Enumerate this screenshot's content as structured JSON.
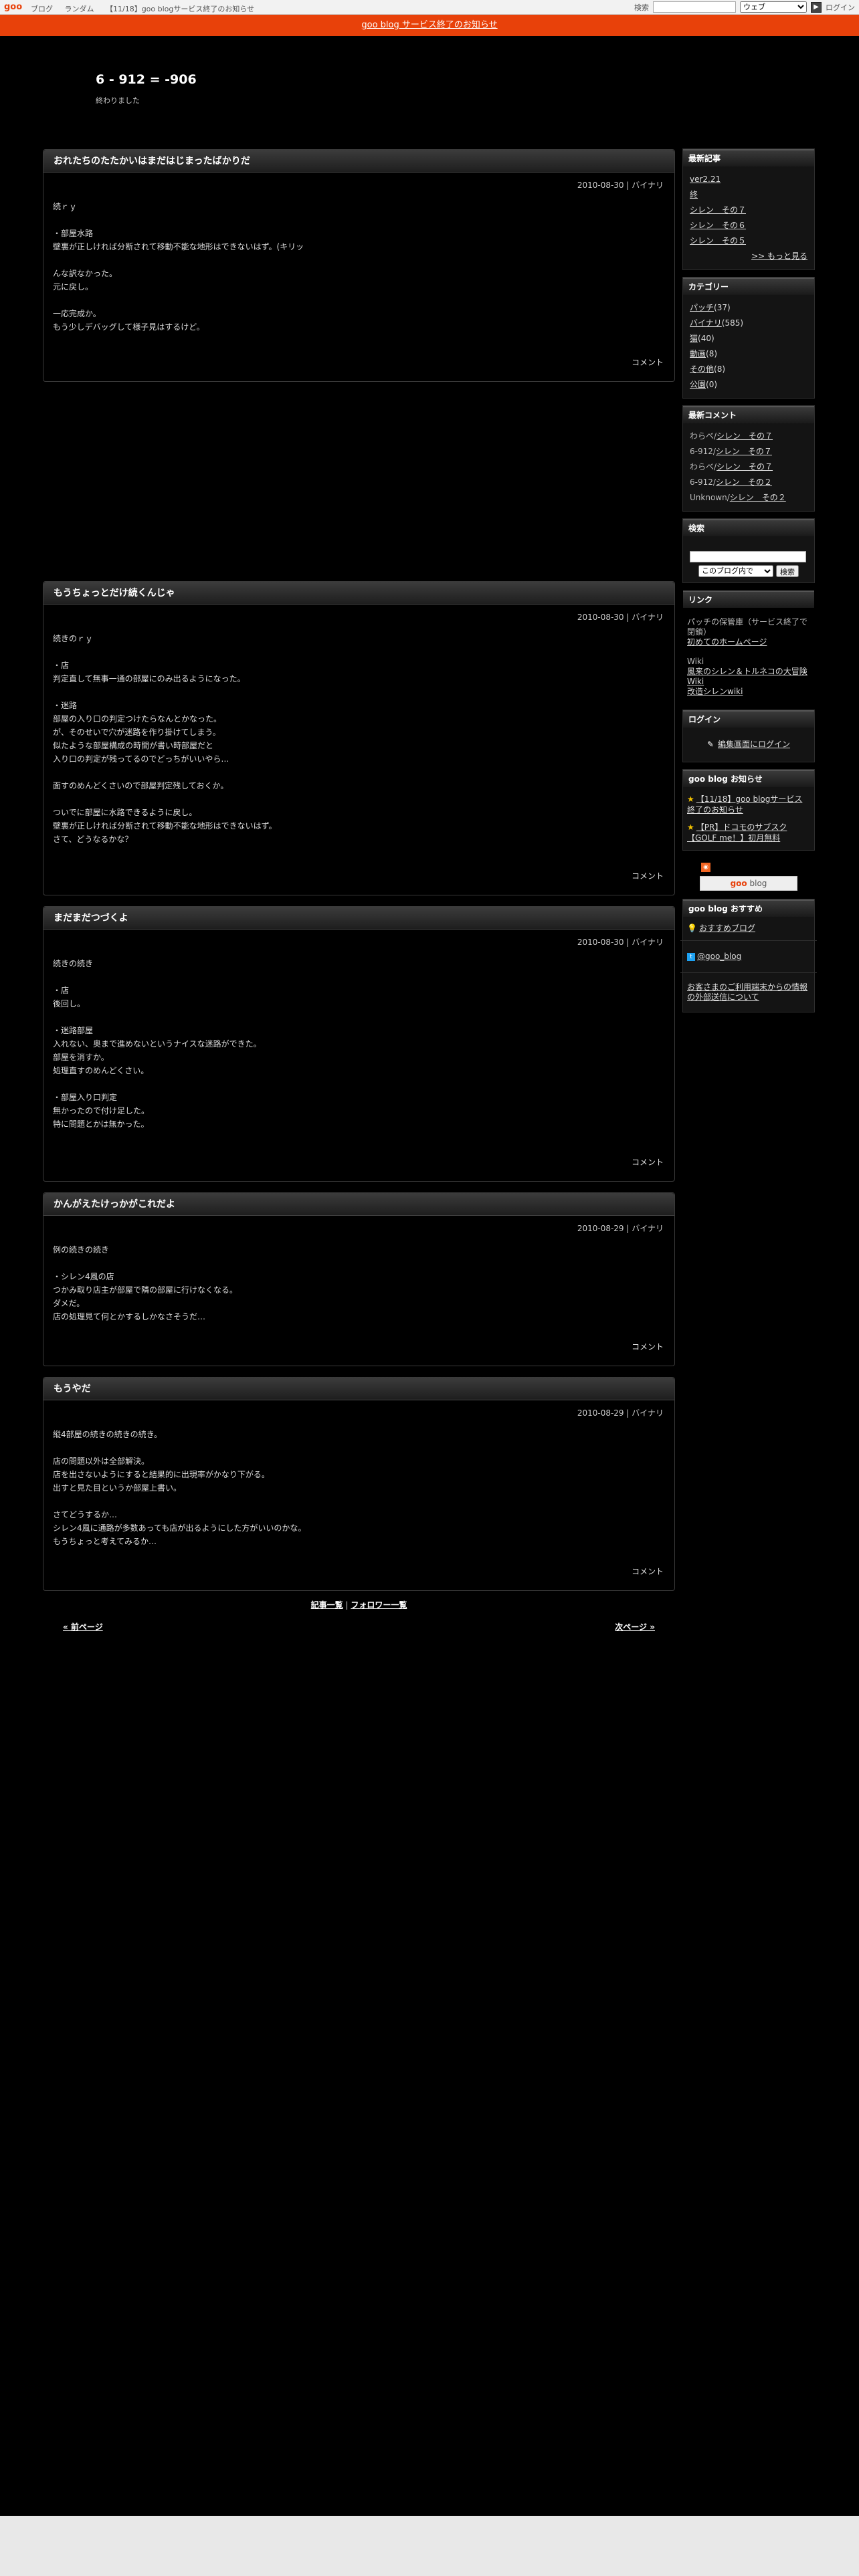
{
  "topbar": {
    "logo": "goo",
    "nav": [
      "ブログ",
      "ランダム",
      "【11/18】goo blogサービス終了のお知らせ"
    ],
    "search_label": "検索",
    "search_scope": "ウェブ",
    "login": "ログイン"
  },
  "notice": "goo blog サービス終了のお知らせ",
  "blog": {
    "title": "6 - 912 = -906",
    "description": "終わりました"
  },
  "entries": [
    {
      "title": "おれたちのたたかいはまだはじまったばかりだ",
      "date": "2010-08-30 | バイナリ",
      "body": "続ｒｙ\n\n・部屋水路\n壁裏が正しければ分断されて移動不能な地形はできないはず。(キリッ\n\nんな訳なかった。\n元に戻し。\n\n一応完成か。\nもう少しデバッグして様子見はするけど。",
      "comment": "コメント"
    },
    {
      "title": "もうちょっとだけ続くんじゃ",
      "date": "2010-08-30 | バイナリ",
      "body": "続きのｒｙ\n\n・店\n判定直して無事一通の部屋にのみ出るようになった。\n\n・迷路\n部屋の入り口の判定つけたらなんとかなった。\nが、そのせいで穴が迷路を作り掛けてしまう。\n似たような部屋構成の時間が書い時部屋だと\n入り口の判定が残ってるのでどっちがいいやら…\n\n面すのめんどくさいので部屋判定残しておくか。\n\nついでに部屋に水路できるように戻し。\n壁裏が正しければ分断されて移動不能な地形はできないはず。\nさて、どうなるかな？",
      "comment": "コメント"
    },
    {
      "title": "まだまだつづくよ",
      "date": "2010-08-30 | バイナリ",
      "body": "続きの続き\n\n・店\n後回し。\n\n・迷路部屋\n入れない、奥まで進めないというナイスな迷路ができた。\n部屋を消すか。\n処理直すのめんどくさい。\n\n・部屋入り口判定\n無かったので付け足した。\n特に問題とかは無かった。",
      "comment": "コメント"
    },
    {
      "title": "かんがえたけっかがこれだよ",
      "date": "2010-08-29 | バイナリ",
      "body": "例の続きの続き\n\n・シレン4風の店\nつかみ取り店主が部屋で隣の部屋に行けなくなる。\nダメだ。\n店の処理見て何とかするしかなさそうだ…",
      "comment": "コメント"
    },
    {
      "title": "もうやだ",
      "date": "2010-08-29 | バイナリ",
      "body": "縦4部屋の続きの続きの続き。\n\n店の問題以外は全部解決。\n店を出さないようにすると結果的に出現率がかなり下がる。\n出すと見た目というか部屋上書い。\n\nさてどうするか…\nシレン4風に通路が多数あっても店が出るようにした方がいいのかな。\nもうちょっと考えてみるか…",
      "comment": "コメント"
    }
  ],
  "list_links": {
    "articles": "記事一覧",
    "separator": "|",
    "followers": "フォロワー一覧"
  },
  "pager": {
    "prev": "« 前ページ",
    "next": "次ページ »"
  },
  "sidebar": {
    "recent_title": "最新記事",
    "recent": [
      "ver2.21",
      "終",
      "シレン　その７",
      "シレン　その６",
      "シレン　その５"
    ],
    "more": ">> もっと見る",
    "category_title": "カテゴリー",
    "categories": [
      {
        "name": "パッチ",
        "count": "(37)"
      },
      {
        "name": "バイナリ",
        "count": "(585)"
      },
      {
        "name": "猫",
        "count": "(40)"
      },
      {
        "name": "動画",
        "count": "(8)"
      },
      {
        "name": "その他",
        "count": "(8)"
      },
      {
        "name": "公園",
        "count": "(0)"
      }
    ],
    "comments_title": "最新コメント",
    "comments": [
      {
        "who": "わらべ/",
        "what": "シレン　その７"
      },
      {
        "who": "6-912/",
        "what": "シレン　その７"
      },
      {
        "who": "わらべ/",
        "what": "シレン　その７"
      },
      {
        "who": "6-912/",
        "what": "シレン　その２"
      },
      {
        "who": "Unknown/",
        "what": "シレン　その２"
      }
    ],
    "search_title": "検索",
    "search_scope": "このブログ内で",
    "search_button": "検索",
    "links_title": "リンク",
    "links_text": "パッチの保管庫（サービス終了で閉鎖）",
    "links_item": "初めてのホームページ",
    "wiki_label": "Wiki",
    "wiki_links": [
      "風来のシレン＆トルネコの大冒険 Wiki",
      "改造シレンwiki"
    ],
    "login_title": "ログイン",
    "login_link": "編集画面にログイン",
    "news_title": "goo blog お知らせ",
    "news": [
      "【11/18】goo blogサービス終了のお知らせ",
      "【PR】ドコモのサブスク【GOLF me！】初月無料"
    ],
    "badge_goo": "goo",
    "badge_blog": " blog",
    "recommend_title": "goo blog おすすめ",
    "recommend_link": "おすすめブログ",
    "twitter": "@goo_blog",
    "report": "お客さまのご利用端末からの情報の外部送信について"
  }
}
